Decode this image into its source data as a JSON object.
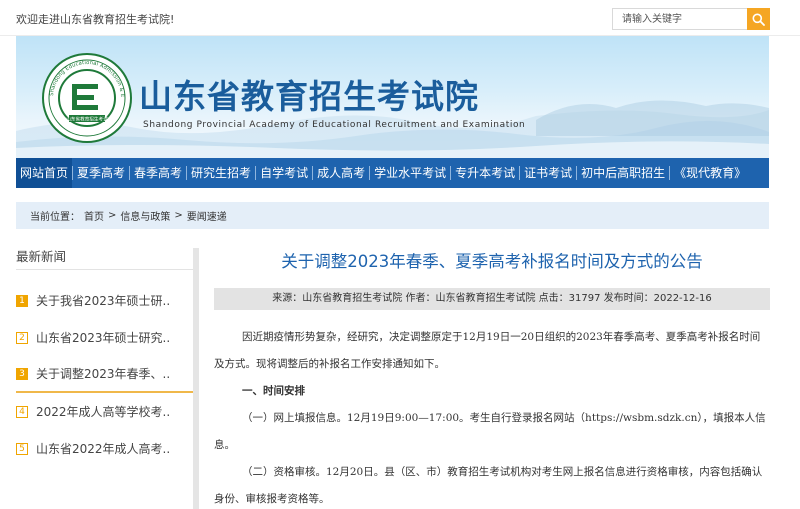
{
  "header": {
    "welcome": "欢迎走进山东省教育招生考试院!",
    "search_placeholder": "请输入关键字"
  },
  "banner": {
    "title": "山东省教育招生考试院",
    "subtitle": "Shandong Provincial Academy of Educational Recruitment and Examination",
    "emblem_ring_text": "Shandong Educational Admission & Examination",
    "emblem_inner_text": "山东省教育招生考试"
  },
  "nav": {
    "items": [
      {
        "label": "网站首页"
      },
      {
        "label": "夏季高考"
      },
      {
        "label": "春季高考"
      },
      {
        "label": "研究生招考"
      },
      {
        "label": "自学考试"
      },
      {
        "label": "成人高考"
      },
      {
        "label": "学业水平考试"
      },
      {
        "label": "专升本考试"
      },
      {
        "label": "证书考试"
      },
      {
        "label": "初中后高职招生"
      },
      {
        "label": "《现代教育》"
      }
    ]
  },
  "breadcrumb": {
    "prefix": "当前位置：",
    "items": [
      "首页",
      "信息与政策",
      "要闻速递"
    ],
    "separator": ">"
  },
  "sidebar": {
    "title": "最新新闻",
    "items": [
      {
        "num": "1",
        "text": "关于我省2023年硕士研.."
      },
      {
        "num": "2",
        "text": "山东省2023年硕士研究.."
      },
      {
        "num": "3",
        "text": "关于调整2023年春季、.."
      },
      {
        "num": "4",
        "text": "2022年成人高等学校考.."
      },
      {
        "num": "5",
        "text": "山东省2022年成人高考.."
      }
    ]
  },
  "article": {
    "title": "关于调整2023年春季、夏季高考补报名时间及方式的公告",
    "meta": "来源：山东省教育招生考试院 作者：山东省教育招生考试院 点击：31797 发布时间：2022-12-16",
    "paragraphs": [
      "因近期疫情形势复杂，经研究，决定调整原定于12月19日一20日组织的2023年春季高考、夏季高考补报名时间及方式。现将调整后的补报名工作安排通知如下。",
      "一、时间安排",
      "（一）网上填报信息。12月19日9:00—17:00。考生自行登录报名网站（https://wsbm.sdzk.cn），填报本人信息。",
      "（二）资格审核。12月20日。县（区、市）教育招生考试机构对考生网上报名信息进行资格审核，内容包括确认身份、审核报考资格等。"
    ]
  },
  "colors": {
    "nav_blue": "#1e63ae",
    "accent_orange": "#f5a623",
    "title_blue": "#1a5d9c"
  },
  "icons": [
    "search-icon",
    "emblem-logo"
  ]
}
